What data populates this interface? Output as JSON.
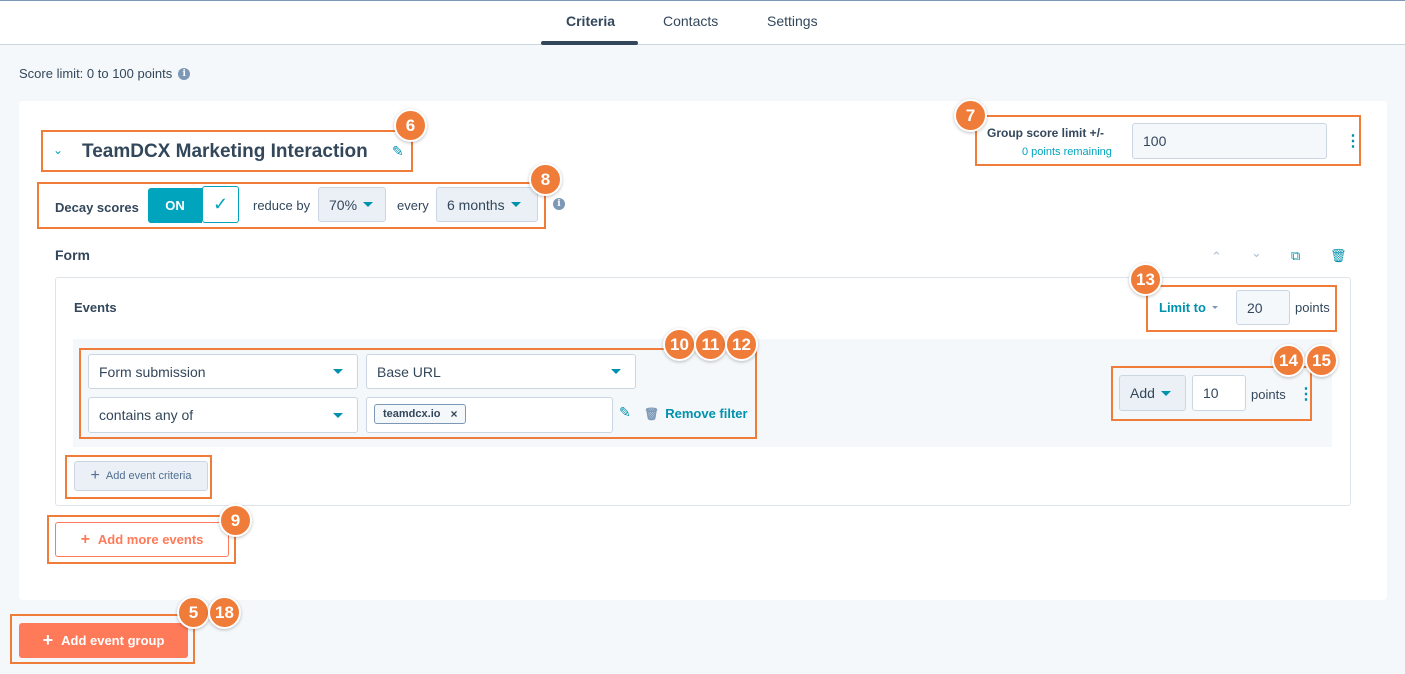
{
  "tabs": [
    {
      "label": "Criteria",
      "active": true
    },
    {
      "label": "Contacts",
      "active": false
    },
    {
      "label": "Settings",
      "active": false
    }
  ],
  "score_limit": "Score limit: 0 to 100 points",
  "group": {
    "title": "TeamDCX Marketing Interaction",
    "score_limit_label": "Group score limit +/-",
    "points_remaining": "0 points remaining",
    "score_limit_value": "100"
  },
  "decay": {
    "label": "Decay scores",
    "toggle": "ON",
    "reduce_by_label": "reduce by",
    "reduce_by_value": "70%",
    "every_label": "every",
    "every_value": "6 months"
  },
  "form_section": {
    "title": "Form",
    "events_label": "Events",
    "limit_to_label": "Limit to",
    "limit_value": "20",
    "points_label": "points"
  },
  "criteria": {
    "event_type": "Form submission",
    "property": "Base URL",
    "operator": "contains any of",
    "chip": "teamdcx.io",
    "remove_filter": "Remove filter",
    "action": "Add",
    "action_value": "10",
    "points_label": "points"
  },
  "buttons": {
    "add_event_criteria": "Add event criteria",
    "add_more_events": "Add more events",
    "add_event_group": "Add event group"
  },
  "badges": [
    "6",
    "7",
    "8",
    "9",
    "10",
    "11",
    "12",
    "13",
    "14",
    "15",
    "5",
    "18"
  ],
  "colors": {
    "accent": "#00a4bd",
    "highlight": "#f07c39",
    "primary": "#ff7a59"
  }
}
